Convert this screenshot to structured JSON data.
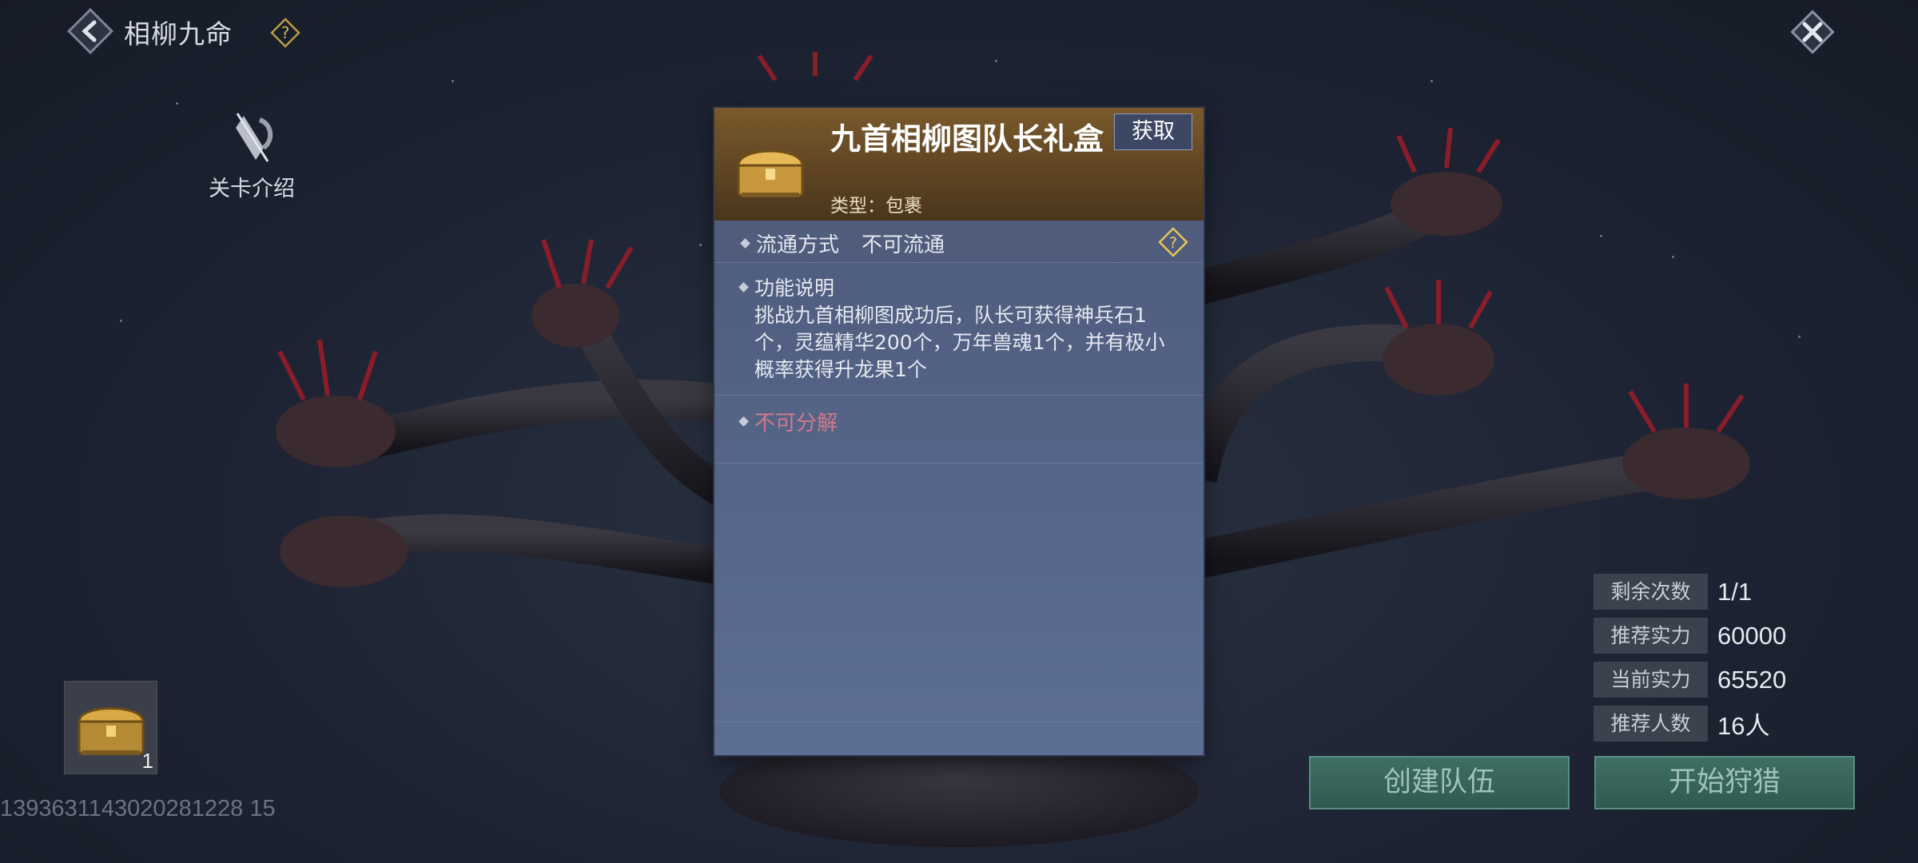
{
  "window": {
    "title": "相柳九命"
  },
  "intro": {
    "label": "关卡介绍"
  },
  "inventory": {
    "count": "1"
  },
  "player": {
    "uid": "1393631143020281228 15"
  },
  "stats": [
    {
      "label": "剩余次数",
      "value": "1/1"
    },
    {
      "label": "推荐实力",
      "value": "60000"
    },
    {
      "label": "当前实力",
      "value": "65520"
    },
    {
      "label": "推荐人数",
      "value": "16人"
    }
  ],
  "actions": {
    "create_team": "创建队伍",
    "start_hunt": "开始狩猎"
  },
  "tooltip": {
    "title": "九首相柳图队长礼盒",
    "get_label": "获取",
    "type": "类型：包裹",
    "circulation_label": "流通方式",
    "circulation_value": "不可流通",
    "function_title": "功能说明",
    "function_desc": "挑战九首相柳图成功后，队长可获得神兵石1个，灵蕴精华200个，万年兽魂1个，并有极小概率获得升龙果1个",
    "decompose": "不可分解"
  },
  "icons": {
    "back": "chevron-left-icon",
    "help": "question-mark-icon",
    "close": "close-x-icon",
    "intro": "scroll-quill-icon",
    "chest": "treasure-chest-icon"
  },
  "colors": {
    "panel_head": "#6a4d26",
    "panel_body": "#56668a",
    "button": "#3f6e64",
    "warning_text": "#d07a8a"
  }
}
